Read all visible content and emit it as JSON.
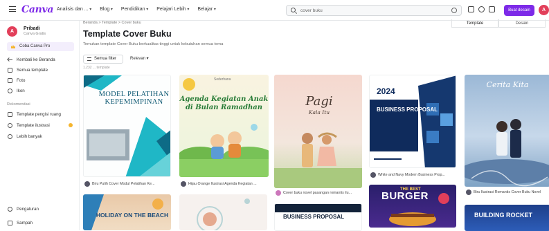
{
  "app": {
    "logo": "Canva",
    "nav": [
      "Analisis dan ...",
      "Blog",
      "Pendidikan",
      "Pelajari Lebih",
      "Belajar"
    ],
    "search_value": "cover buku",
    "create_button": "Buat desain",
    "avatar_initial": "A"
  },
  "user": {
    "initial": "A",
    "name": "Pribadi",
    "plan": "Canva Gratis"
  },
  "sidebar": {
    "pro": "Coba Canva Pro",
    "items": [
      {
        "label": "Kembali ke Beranda",
        "icon": "back-arrow-icon"
      },
      {
        "label": "Semua template",
        "icon": "grid-icon"
      },
      {
        "label": "Foto",
        "icon": "photo-icon"
      },
      {
        "label": "Ikon",
        "icon": "icons-icon"
      }
    ],
    "section_label": "Rekomendasi",
    "sub_items": [
      {
        "label": "Template pengisi ruang",
        "icon": "template-icon"
      },
      {
        "label": "Template ilustrasi",
        "icon": "crown-icon"
      },
      {
        "label": "Lebih banyak",
        "icon": "more-icon"
      }
    ],
    "bottom": [
      {
        "label": "Pengaturan",
        "icon": "settings-icon"
      },
      {
        "label": "Sampah",
        "icon": "trash-icon"
      }
    ]
  },
  "main": {
    "breadcrumb": "Beranda  >  Template  >  Cover buku",
    "tabs": [
      "Template",
      "Desain"
    ],
    "title": "Template Cover Buku",
    "description": "Temukan template Cover Buku berkualitas tinggi untuk kebutuhan semua tema",
    "filter_label": "Semua filter",
    "sort_label": "Relevan",
    "result_count": "1.232 ... template"
  },
  "row1": [
    {
      "title": "MODEL PELATIHAN KEPEMIMPINAN",
      "caption": "Biru Putih Cover Modul Pelatihan Ke...",
      "colors": {
        "bg": "#ffffff",
        "accent": "#19b8c8"
      }
    },
    {
      "top": "Sederhana",
      "title": "Agenda Kegiatan Anak di Bulan Ramadhan",
      "caption": "Hijau Orange Ilustrasi Agenda Kegiatan ..."
    },
    {
      "title": "Pagi",
      "subtitle": "Kala Itu",
      "caption": "Cover buku novel pasangan romantis ilu..."
    },
    {
      "year": "2024",
      "title": "BUSINESS PROPOSAL",
      "caption": "White and Navy Modern Business Prop..."
    },
    {
      "title": "Cerita Kita",
      "caption": "Biru Ilustrasi Romantis Cover Buku Novel"
    }
  ],
  "row2": [
    {
      "title": "HOLIDAY ON THE BEACH"
    },
    {
      "title": ""
    },
    {
      "title": "BUSINESS PROPOSAL"
    },
    {
      "top": "THE BEST",
      "title": "BURGER"
    },
    {
      "title": "BUILDING ROCKET"
    }
  ]
}
